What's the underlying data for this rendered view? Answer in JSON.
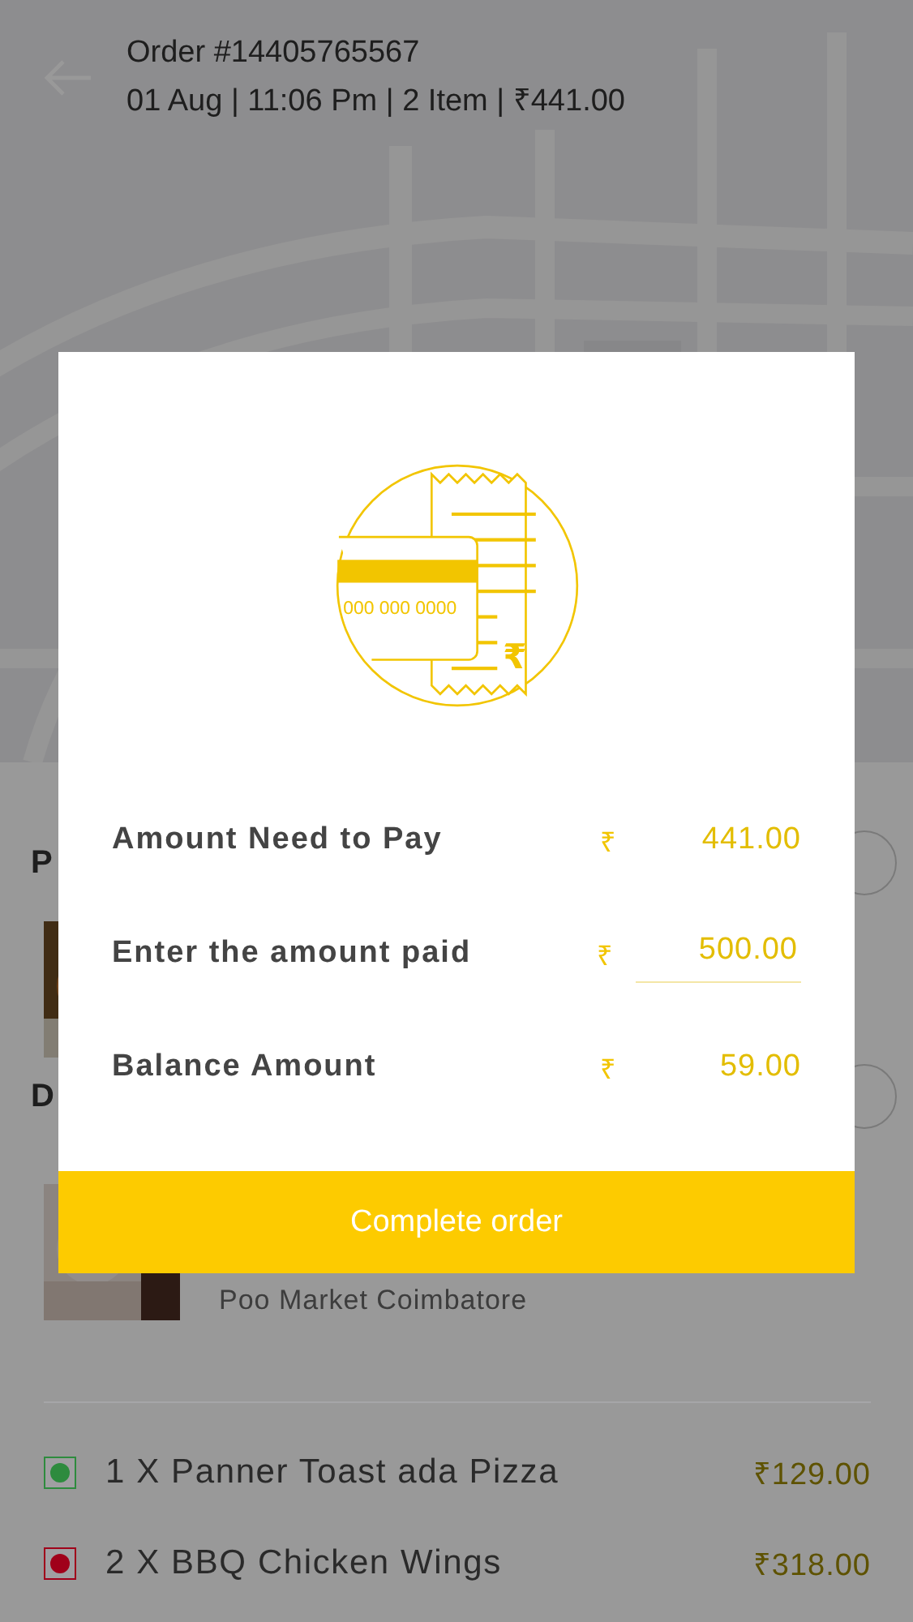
{
  "header": {
    "order": "Order #14405765567",
    "meta": "01 Aug | 11:06 Pm | 2 Item | ₹441.00"
  },
  "sections": [
    {
      "title": "P"
    },
    {
      "title": "D",
      "subtitle": "Poo Market Coimbatore"
    }
  ],
  "items": [
    {
      "name": "1 X Panner Toast ada Pizza",
      "price": "₹129.00",
      "color": "#2e8b3e"
    },
    {
      "name": "2 X BBQ Chicken Wings",
      "price": "₹318.00",
      "color": "#a0001a"
    }
  ],
  "dialog": {
    "illustration": {
      "card_number": "000 000 0000",
      "symbol": "₹"
    },
    "rows": [
      {
        "kind": "static",
        "label": "Amount Need to Pay",
        "currency": "₹",
        "value": "441.00"
      },
      {
        "kind": "input",
        "label": "Enter the amount paid",
        "currency": "₹",
        "value": "500.00"
      },
      {
        "kind": "static",
        "label": "Balance Amount",
        "currency": "₹",
        "value": "59.00"
      }
    ],
    "button": "Complete order"
  }
}
